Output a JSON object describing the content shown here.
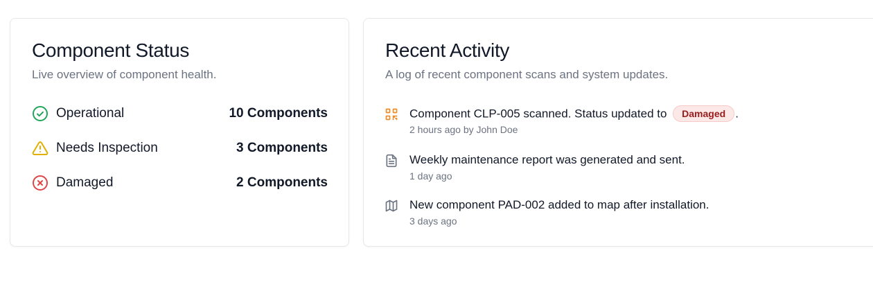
{
  "status_card": {
    "title": "Component Status",
    "subtitle": "Live overview of component health.",
    "rows": [
      {
        "label": "Operational",
        "count": "10 Components",
        "icon": "check-circle-icon",
        "color": "#22a559"
      },
      {
        "label": "Needs Inspection",
        "count": "3 Components",
        "icon": "warning-triangle-icon",
        "color": "#e0b000"
      },
      {
        "label": "Damaged",
        "count": "2 Components",
        "icon": "x-circle-icon",
        "color": "#e04545"
      }
    ]
  },
  "activity_card": {
    "title": "Recent Activity",
    "subtitle": "A log of recent component scans and system updates.",
    "items": [
      {
        "text_before": "Component CLP-005 scanned. Status updated to",
        "badge": "Damaged",
        "text_after": ".",
        "meta": "2 hours ago by John Doe",
        "icon": "qr-code-icon",
        "icon_color": "#f08a24"
      },
      {
        "text": "Weekly maintenance report was generated and sent.",
        "meta": "1 day ago",
        "icon": "document-icon",
        "icon_color": "#6b7280"
      },
      {
        "text": "New component PAD-002 added to map after installation.",
        "meta": "3 days ago",
        "icon": "map-icon",
        "icon_color": "#6b7280"
      }
    ]
  },
  "colors": {
    "badge_bg": "#fde8e8",
    "badge_text": "#991b1b",
    "muted_text": "#6b7280",
    "border": "#e5e7eb"
  }
}
